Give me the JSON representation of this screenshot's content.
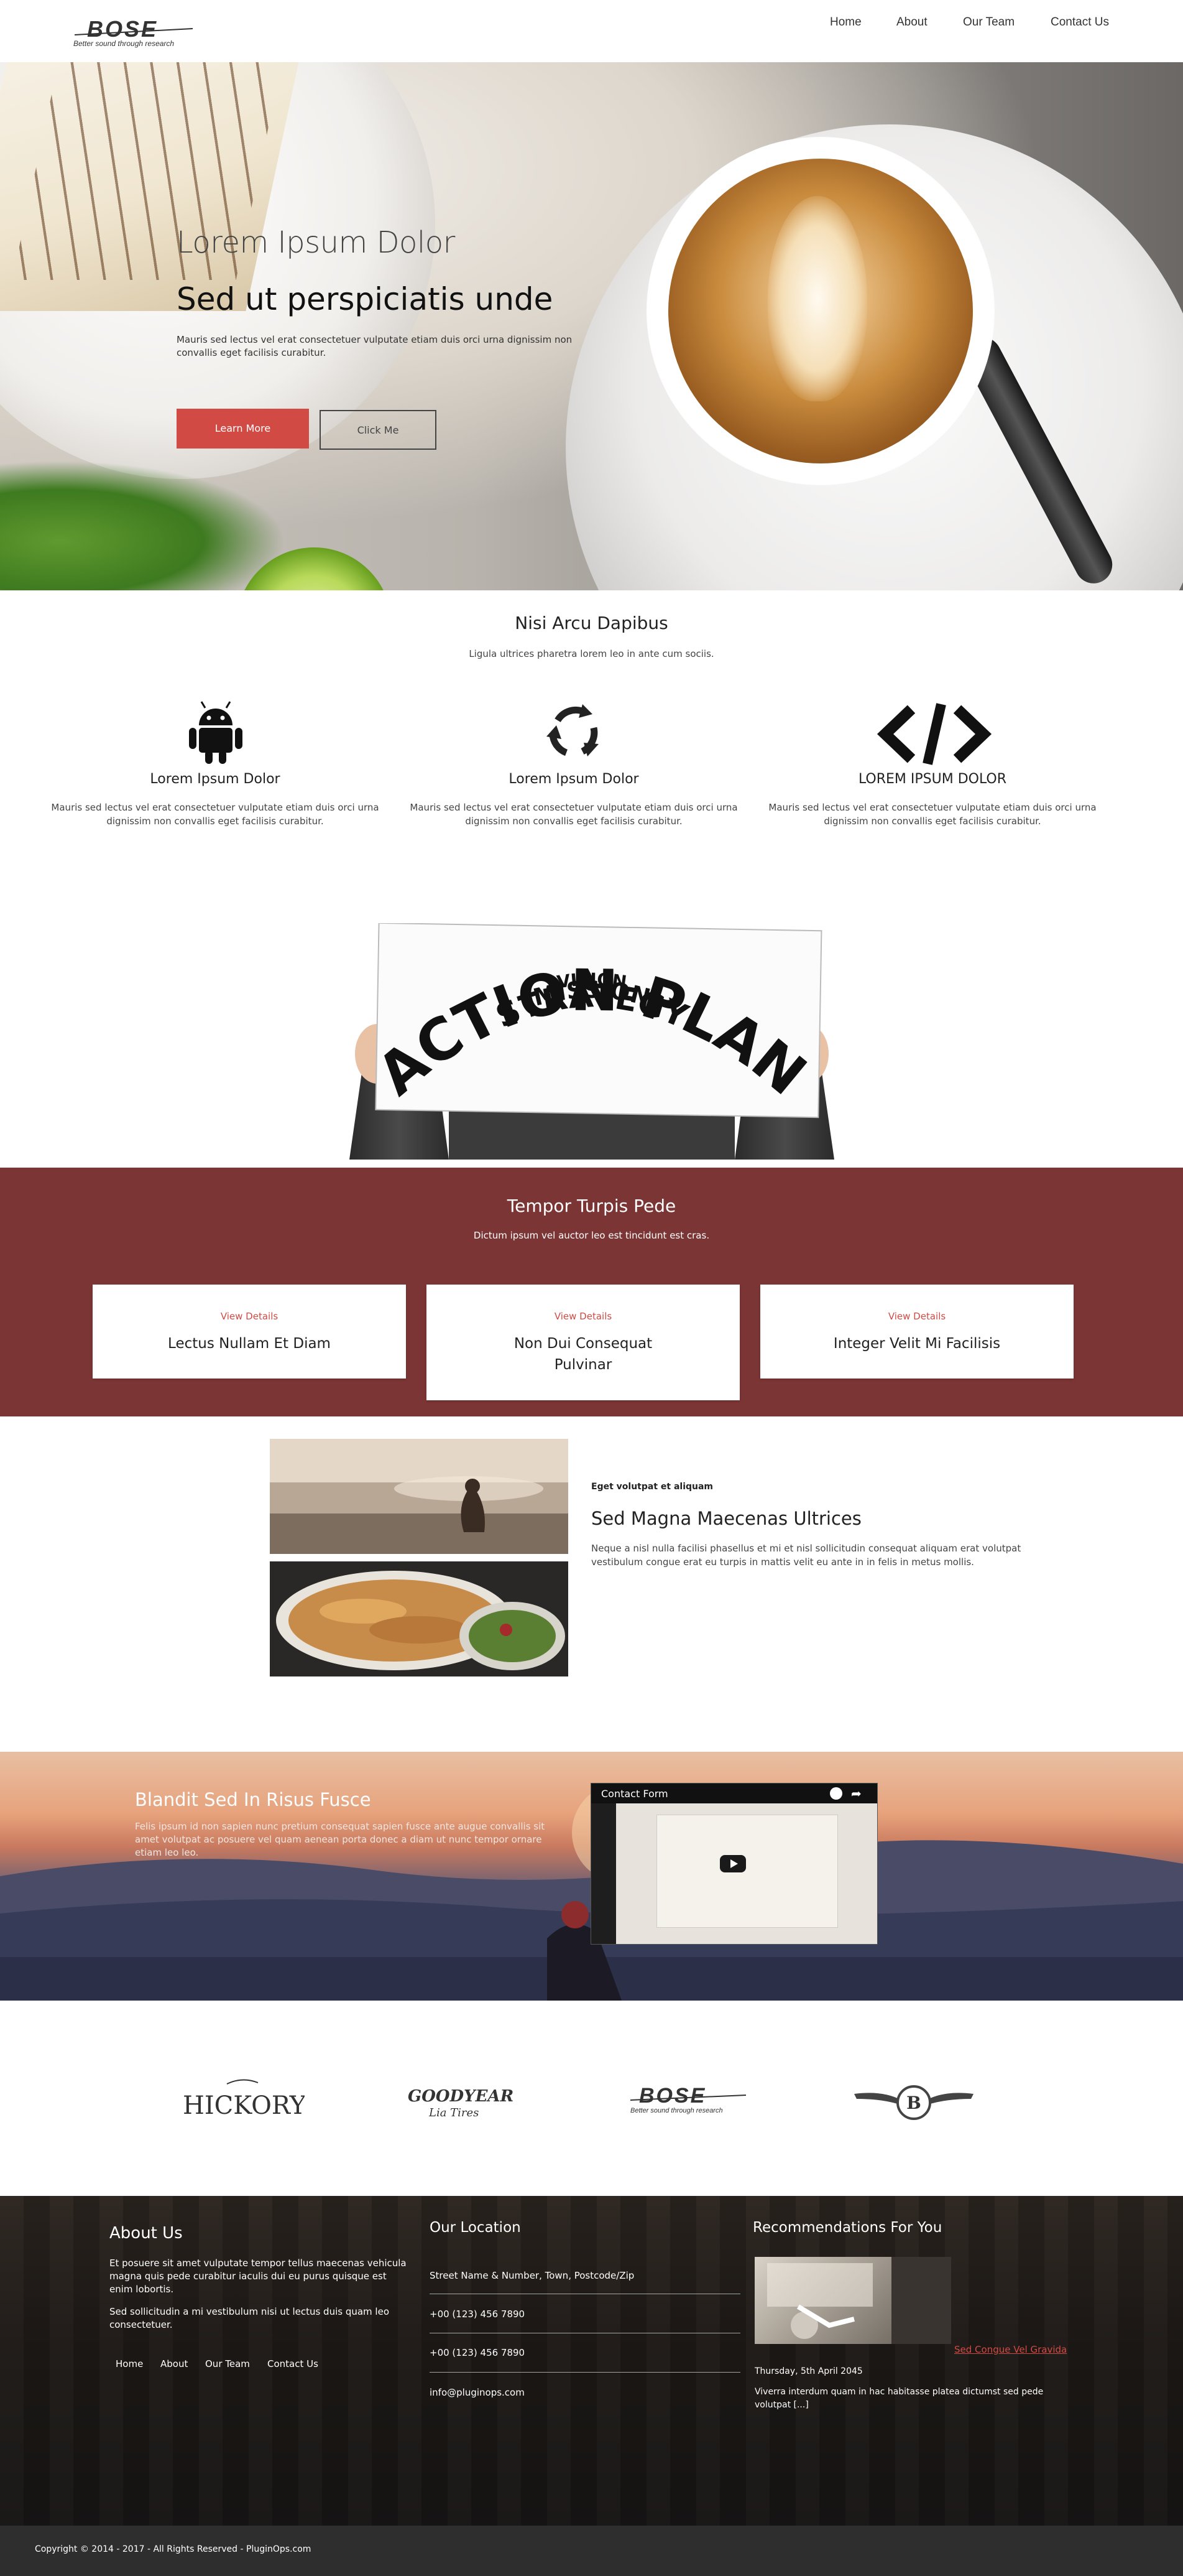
{
  "header": {
    "logo_text": "BOSE",
    "logo_tagline": "Better sound through research",
    "nav": [
      "Home",
      "About",
      "Our Team",
      "Contact Us"
    ]
  },
  "hero": {
    "title": "Lorem Ipsum Dolor",
    "subtitle": "Sed ut perspiciatis unde",
    "text": "Mauris sed lectus vel erat consectetuer vulputate etiam duis orci urna dignissim non convallis eget facilisis curabitur.",
    "btn_primary": "Learn More",
    "btn_secondary": "Click Me"
  },
  "features": {
    "title": "Nisi Arcu Dapibus",
    "subtitle": "Ligula ultrices pharetra lorem leo in ante cum sociis.",
    "items": [
      {
        "icon": "android-icon",
        "title": "Lorem Ipsum Dolor",
        "text": "Mauris sed lectus vel erat consectetuer vulputate etiam duis orci urna dignissim non convallis eget facilisis curabitur."
      },
      {
        "icon": "recycle-icon",
        "title": "Lorem Ipsum Dolor",
        "text": "Mauris sed lectus vel erat consectetuer vulputate etiam duis orci urna dignissim non convallis eget facilisis curabitur."
      },
      {
        "icon": "code-icon",
        "title": "LOREM IPSUM DOLOR",
        "text": "Mauris sed lectus vel erat consectetuer vulputate etiam duis orci urna dignissim non convallis eget facilisis curabitur."
      }
    ]
  },
  "action_plan": {
    "words": [
      "VISION",
      "MISSION",
      "STRATEGY",
      "ACTION PLAN"
    ]
  },
  "services": {
    "title": "Tempor Turpis Pede",
    "subtitle": "Dictum ipsum vel auctor leo est tincidunt est cras.",
    "cards": [
      {
        "link": "View Details",
        "title": "Lectus Nullam Et Diam"
      },
      {
        "link": "View Details",
        "title": "Non Dui Consequat Pulvinar"
      },
      {
        "link": "View Details",
        "title": "Integer Velit Mi Facilisis"
      }
    ]
  },
  "feature_post": {
    "kicker": "Eget volutpat et aliquam",
    "title": "Sed Magna Maecenas Ultrices",
    "text": "Neque a nisl nulla facilisi phasellus et mi et nisl sollicitudin consequat aliquam erat volutpat vestibulum congue erat eu turpis in mattis velit eu ante in in felis in metus mollis."
  },
  "video_section": {
    "title": "Blandit Sed In Risus Fusce",
    "text": "Felis ipsum id non sapien nunc pretium consequat sapien fusce ante augue convallis sit amet volutpat ac posuere vel quam aenean porta donec a diam ut nunc tempor ornare etiam leo leo.",
    "video_title": "Contact Form"
  },
  "clients": [
    "HICKORY",
    "GOODYEAR",
    "BOSE",
    "BENTLEY"
  ],
  "clients_sub": {
    "goodyear": "Lia Tires",
    "bose": "Better sound through research"
  },
  "footer": {
    "about": {
      "title": "About Us",
      "p1": "Et posuere sit amet vulputate tempor tellus maecenas vehicula magna quis pede curabitur iaculis dui eu purus quisque est enim lobortis.",
      "p2": "Sed sollicitudin a mi vestibulum nisi ut lectus duis quam leo consectetuer.",
      "links": [
        "Home",
        "About",
        "Our Team",
        "Contact Us"
      ]
    },
    "location": {
      "title": "Our Location",
      "address": "Street Name & Number, Town, Postcode/Zip",
      "phone1": "+00 (123) 456 7890",
      "phone2": "+00 (123) 456 7890",
      "email": "info@pluginops.com"
    },
    "recommend": {
      "title": "Recommendations For You",
      "link": "Sed Congue Vel Gravida",
      "date": "Thursday, 5th April 2045",
      "text": "Viverra interdum quam in hac habitasse platea dictumst sed pede volutpat [...]"
    },
    "copyright": "Copyright © 2014 - 2017 - All Rights Reserved - PluginOps.com"
  },
  "colors": {
    "accent": "#d24a44",
    "section_red": "#7c3535",
    "footer_bar": "#2e2e2e"
  }
}
